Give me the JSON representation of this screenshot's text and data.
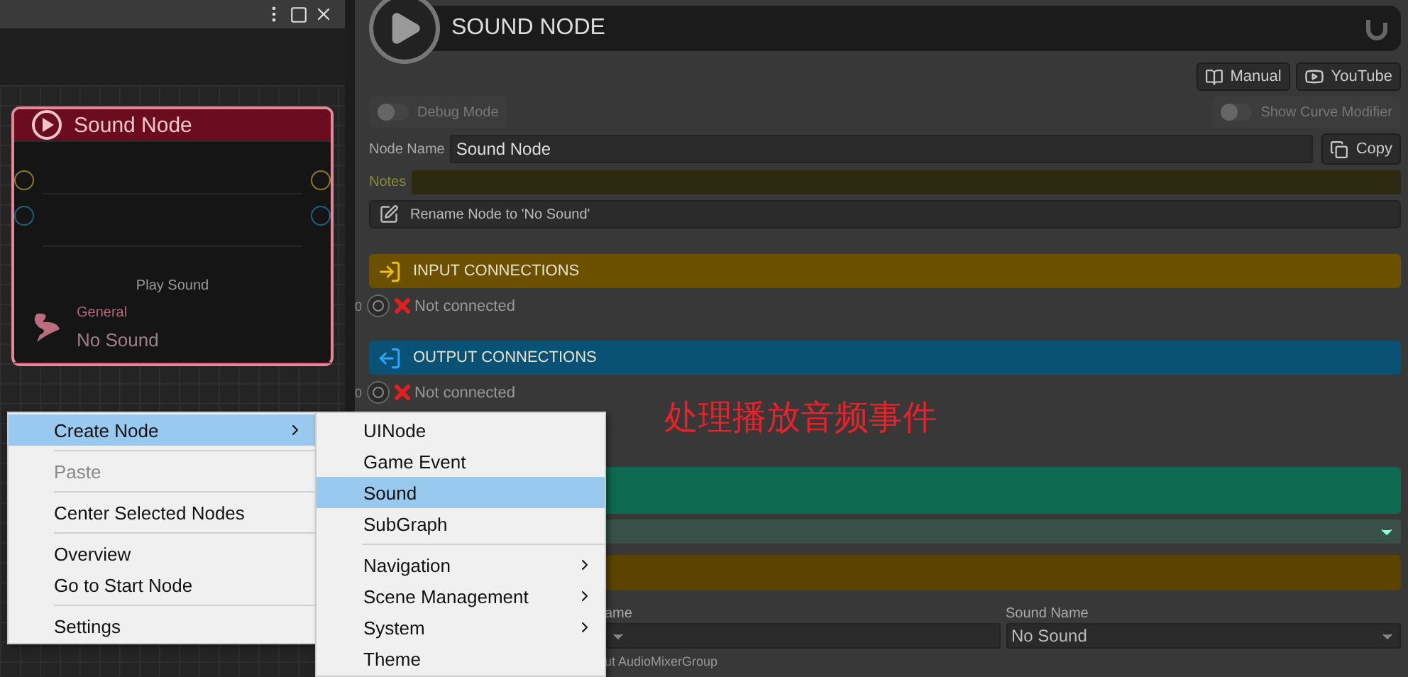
{
  "graph": {
    "node": {
      "title": "Sound Node",
      "selected": true,
      "subtitle": "Play Sound",
      "category": "General",
      "value": "No Sound"
    }
  },
  "inspector": {
    "title": "SOUND NODE",
    "buttons": [
      {
        "kind": "manual",
        "label": "Manual"
      },
      {
        "kind": "video",
        "label": "YouTube"
      }
    ],
    "toggles": [
      {
        "label": "Debug Mode",
        "on": false
      },
      {
        "label": "Show Curve Modifier",
        "on": false
      }
    ],
    "node_name": {
      "label": "Node Name",
      "value": "Sound Node"
    },
    "copy_button": "Copy",
    "notes": {
      "label": "Notes"
    },
    "rename_button": "Rename Node to 'No Sound'",
    "sections": [
      {
        "kind": "input",
        "title": "INPUT CONNECTIONS",
        "connections": [
          {
            "index": "0",
            "status": "Not connected"
          }
        ]
      },
      {
        "kind": "output",
        "title": "OUTPUT CONNECTIONS",
        "connections": [
          {
            "index": "0",
            "status": "Not connected"
          }
        ]
      }
    ],
    "fields": [
      {
        "label": "ame"
      },
      {
        "label": "Sound Name",
        "value": "No Sound"
      }
    ],
    "footnote": "ut AudioMixerGroup"
  },
  "annotation": "处理播放音频事件",
  "context_menu": {
    "groups": [
      [
        {
          "label": "Create Node",
          "selected": true,
          "disabled": false,
          "submenu": true
        }
      ],
      [
        {
          "label": "Paste",
          "selected": false,
          "disabled": true,
          "submenu": false
        }
      ],
      [
        {
          "label": "Center Selected Nodes",
          "selected": false,
          "disabled": false,
          "submenu": false
        }
      ],
      [
        {
          "label": "Overview",
          "selected": false,
          "disabled": false,
          "submenu": false
        },
        {
          "label": "Go to Start Node",
          "selected": false,
          "disabled": false,
          "submenu": false
        }
      ],
      [
        {
          "label": "Settings",
          "selected": false,
          "disabled": false,
          "submenu": false
        }
      ]
    ]
  },
  "submenu": {
    "groups": [
      [
        {
          "label": "UINode",
          "selected": false,
          "submenu": false
        },
        {
          "label": "Game Event",
          "selected": false,
          "submenu": false
        },
        {
          "label": "Sound",
          "selected": true,
          "submenu": false
        },
        {
          "label": "SubGraph",
          "selected": false,
          "submenu": false
        }
      ],
      [
        {
          "label": "Navigation",
          "selected": false,
          "submenu": true
        },
        {
          "label": "Scene Management",
          "selected": false,
          "submenu": true
        },
        {
          "label": "System",
          "selected": false,
          "submenu": true
        },
        {
          "label": "Theme",
          "selected": false,
          "submenu": false
        }
      ]
    ]
  }
}
